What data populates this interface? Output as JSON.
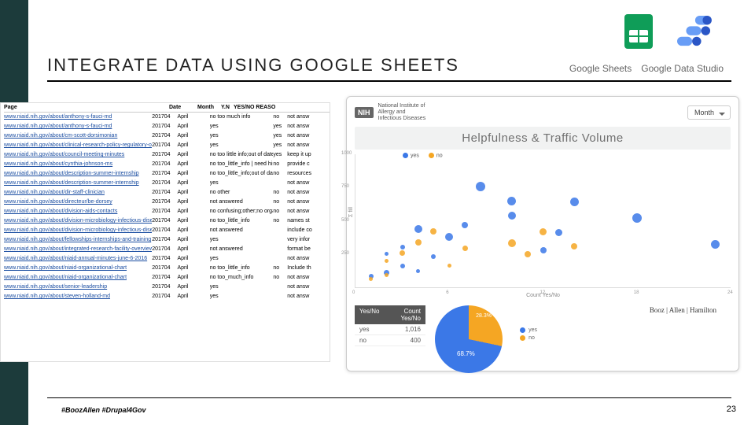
{
  "slide": {
    "title": "INTEGRATE DATA USING GOOGLE SHEETS",
    "hashtag": "#BoozAllen #Drupal4Gov",
    "page_number": "23",
    "product_labels": {
      "sheets": "Google Sheets",
      "datastudio": "Google Data Studio"
    },
    "booz": "Booz | Allen | Hamilton"
  },
  "sheet": {
    "headers": [
      "Page",
      "Date",
      "Month",
      "Y.N",
      "YES/NO REASO",
      ""
    ],
    "rows": [
      [
        "www.niaid.nih.gov/about/anthony-s-fauci-md",
        "201704",
        "April",
        "",
        "no too much info",
        "no",
        "not answ"
      ],
      [
        "www.niaid.nih.gov/about/anthony-s-fauci-md",
        "201704",
        "April",
        "",
        "yes",
        "yes",
        "not answ"
      ],
      [
        "www.niaid.nih.gov/about/cm-scott-dorsimonian",
        "201704",
        "April",
        "",
        "yes",
        "yes",
        "not answ"
      ],
      [
        "www.niaid.nih.gov/about/clinical-research-policy-regulatory-operations",
        "201704",
        "April",
        "",
        "yes",
        "yes",
        "not answ"
      ],
      [
        "www.niaid.nih.gov/about/council-meeting-minutes",
        "201704",
        "April",
        "",
        "no too little info;out of date",
        "yes",
        "keep it up"
      ],
      [
        "www.niaid.nih.gov/about/cynthia-johnson-ms",
        "201704",
        "April",
        "",
        "no too_little_info | need his em",
        "no",
        "provide c"
      ],
      [
        "www.niaid.nih.gov/about/description-summer-internship",
        "201704",
        "April",
        "",
        "no too_little_info;out of date",
        "no",
        "resources"
      ],
      [
        "www.niaid.nih.gov/about/description-summer-internship",
        "201704",
        "April",
        "",
        "yes",
        "",
        "not answ"
      ],
      [
        "www.niaid.nih.gov/about/dir-staff-clinician",
        "201704",
        "April",
        "",
        "no other",
        "no",
        "not answ"
      ],
      [
        "www.niaid.nih.gov/about/directeur/be-dorsey",
        "201704",
        "April",
        "",
        "not answered",
        "no",
        "not answ"
      ],
      [
        "www.niaid.nih.gov/about/division-aids-contacts",
        "201704",
        "April",
        "",
        "no confusing;other;no organiza",
        "no",
        "not answ"
      ],
      [
        "www.niaid.nih.gov/about/division-microbiology-infectious-diseases-org-chart",
        "201704",
        "April",
        "",
        "no too_little_info",
        "no",
        "names st"
      ],
      [
        "www.niaid.nih.gov/about/division-microbiology-infectious-diseases-org-chart",
        "201704",
        "April",
        "",
        "not answered",
        "",
        "include co"
      ],
      [
        "www.niaid.nih.gov/about/fellowships-internships-and-training",
        "201704",
        "April",
        "",
        "yes",
        "",
        "very infor"
      ],
      [
        "www.niaid.nih.gov/about/integrated-research-facility-overview",
        "201704",
        "April",
        "",
        "not answered",
        "",
        "format be"
      ],
      [
        "www.niaid.nih.gov/about/niaid-annual-minutes-june-6-2016",
        "201704",
        "April",
        "",
        "yes",
        "",
        "not answ"
      ],
      [
        "www.niaid.nih.gov/about/niaid-organizational-chart",
        "201704",
        "April",
        "",
        "no too_little_info",
        "no",
        "Include th"
      ],
      [
        "www.niaid.nih.gov/about/niaid-organizational-chart",
        "201704",
        "April",
        "",
        "no too_much_info",
        "no",
        "not answ"
      ],
      [
        "www.niaid.nih.gov/about/senior-leadership",
        "201704",
        "April",
        "",
        "yes",
        "",
        "not answ"
      ],
      [
        "www.niaid.nih.gov/about/steven-holland-md",
        "201704",
        "April",
        "",
        "yes",
        "",
        "not answ"
      ]
    ]
  },
  "datastudio": {
    "nih_label1": "National Institute of",
    "nih_label2": "Allergy and",
    "nih_label3": "Infectious Diseases",
    "month_dropdown": "Month",
    "panel_title": "Helpfulness & Traffic Volume",
    "count_table": {
      "headers": [
        "Yes/No",
        "Count Yes/No"
      ],
      "rows": [
        [
          "yes",
          "1,016"
        ],
        [
          "no",
          "400"
        ]
      ]
    },
    "pie": {
      "slice_no_pct": "28.3%",
      "slice_yes_pct": "68.7%",
      "legend": [
        "yes",
        "no"
      ]
    }
  },
  "chart_data": {
    "type": "scatter",
    "title": "Helpfulness & Traffic Volume",
    "xlabel": "Count Yes/No",
    "ylabel": "Σ fill",
    "xlim": [
      0,
      24
    ],
    "ylim": [
      0,
      1000
    ],
    "x_ticks": [
      0,
      6,
      12,
      18,
      24
    ],
    "y_ticks": [
      250,
      500,
      750,
      1000
    ],
    "legend": [
      "yes",
      "no"
    ],
    "series": [
      {
        "name": "yes",
        "color": "#3b78e7",
        "points": [
          {
            "x": 1,
            "y": 80,
            "r": 6
          },
          {
            "x": 2,
            "y": 110,
            "r": 7
          },
          {
            "x": 2,
            "y": 250,
            "r": 5
          },
          {
            "x": 3,
            "y": 160,
            "r": 6
          },
          {
            "x": 3,
            "y": 300,
            "r": 6
          },
          {
            "x": 4,
            "y": 120,
            "r": 5
          },
          {
            "x": 4,
            "y": 440,
            "r": 10
          },
          {
            "x": 5,
            "y": 230,
            "r": 6
          },
          {
            "x": 6,
            "y": 380,
            "r": 10
          },
          {
            "x": 7,
            "y": 470,
            "r": 8
          },
          {
            "x": 8,
            "y": 760,
            "r": 12
          },
          {
            "x": 10,
            "y": 540,
            "r": 10
          },
          {
            "x": 10,
            "y": 650,
            "r": 11
          },
          {
            "x": 12,
            "y": 280,
            "r": 8
          },
          {
            "x": 13,
            "y": 410,
            "r": 9
          },
          {
            "x": 14,
            "y": 640,
            "r": 11
          },
          {
            "x": 18,
            "y": 520,
            "r": 12
          },
          {
            "x": 23,
            "y": 320,
            "r": 11
          }
        ]
      },
      {
        "name": "no",
        "color": "#f5a623",
        "points": [
          {
            "x": 1,
            "y": 60,
            "r": 5
          },
          {
            "x": 2,
            "y": 90,
            "r": 5
          },
          {
            "x": 2,
            "y": 200,
            "r": 5
          },
          {
            "x": 3,
            "y": 260,
            "r": 7
          },
          {
            "x": 4,
            "y": 340,
            "r": 8
          },
          {
            "x": 5,
            "y": 420,
            "r": 8
          },
          {
            "x": 6,
            "y": 160,
            "r": 5
          },
          {
            "x": 7,
            "y": 290,
            "r": 7
          },
          {
            "x": 10,
            "y": 330,
            "r": 10
          },
          {
            "x": 11,
            "y": 250,
            "r": 8
          },
          {
            "x": 12,
            "y": 420,
            "r": 9
          },
          {
            "x": 14,
            "y": 310,
            "r": 8
          }
        ]
      }
    ]
  }
}
